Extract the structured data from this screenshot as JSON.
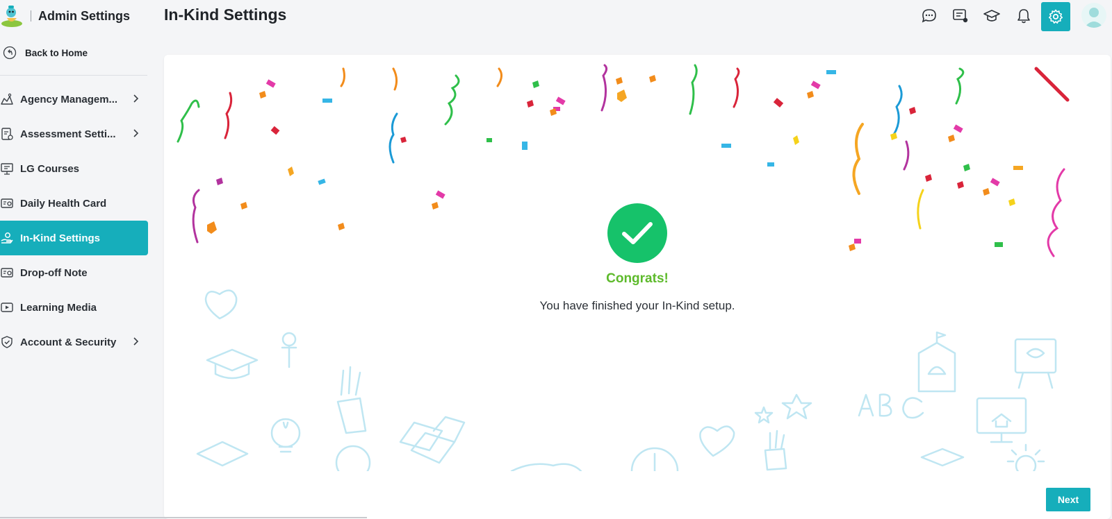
{
  "app": {
    "title": "Admin Settings"
  },
  "sidebar": {
    "back_label": "Back to Home",
    "items": [
      {
        "label": "Agency Managem...",
        "icon": "agency-icon",
        "has_submenu": true,
        "active": false
      },
      {
        "label": "Assessment Setti...",
        "icon": "assessment-icon",
        "has_submenu": true,
        "active": false
      },
      {
        "label": "LG Courses",
        "icon": "courses-icon",
        "has_submenu": false,
        "active": false
      },
      {
        "label": "Daily Health Card",
        "icon": "health-card-icon",
        "has_submenu": false,
        "active": false
      },
      {
        "label": "In-Kind Settings",
        "icon": "in-kind-icon",
        "has_submenu": false,
        "active": true
      },
      {
        "label": "Drop-off Note",
        "icon": "dropoff-note-icon",
        "has_submenu": false,
        "active": false
      },
      {
        "label": "Learning Media",
        "icon": "learning-media-icon",
        "has_submenu": false,
        "active": false
      },
      {
        "label": "Account & Security",
        "icon": "shield-icon",
        "has_submenu": true,
        "active": false
      }
    ]
  },
  "header": {
    "page_title": "In-Kind Settings",
    "icons": [
      "chat-icon",
      "feedback-icon",
      "graduation-cap-icon",
      "bell-icon",
      "gear-icon",
      "avatar"
    ]
  },
  "main": {
    "congrats": "Congrats!",
    "message": "You have finished your In-Kind setup.",
    "next_label": "Next"
  },
  "colors": {
    "accent": "#16aebb",
    "success": "#16c26a",
    "congrats_text": "#5dba2b",
    "doodle": "#bfe6f2"
  }
}
